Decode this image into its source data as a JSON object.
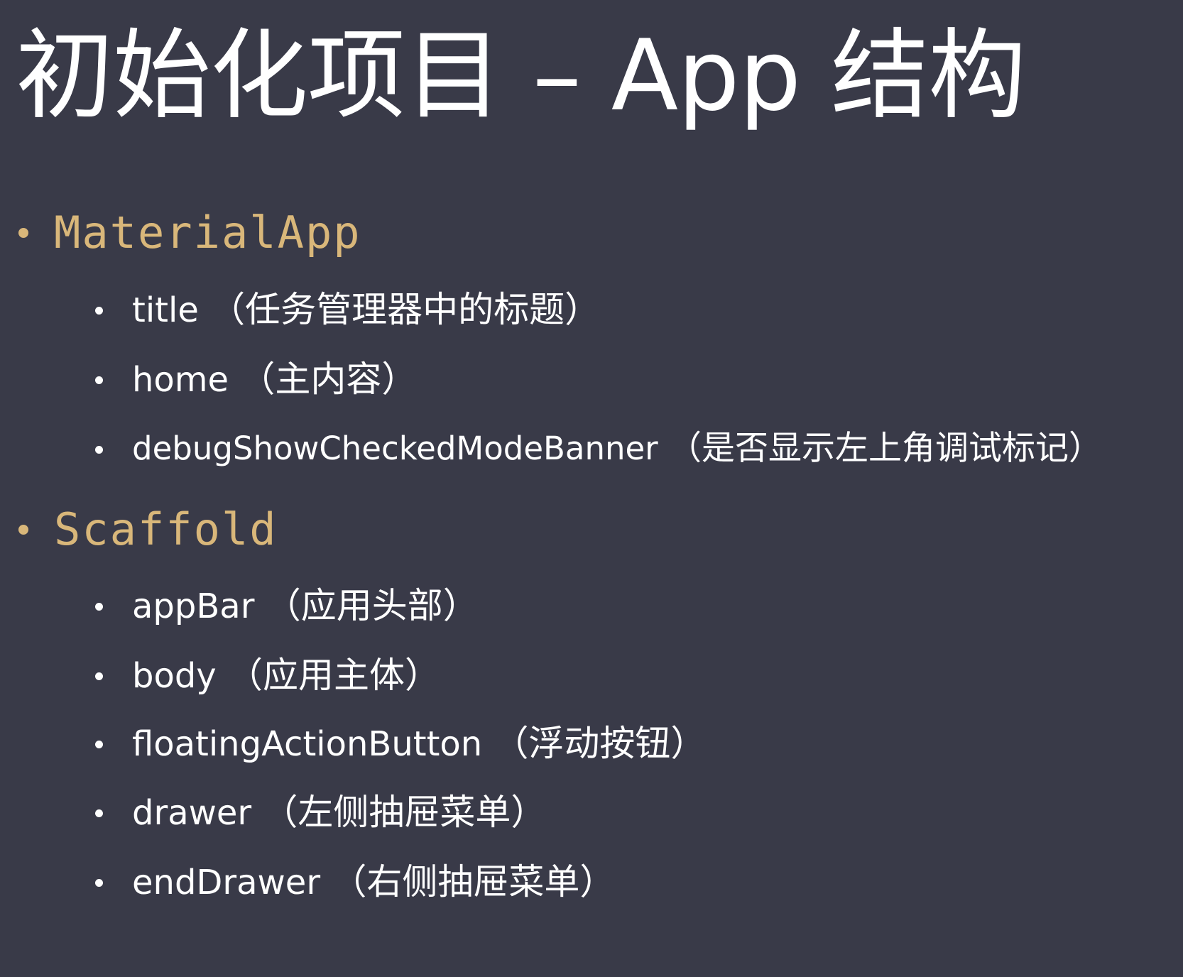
{
  "slide": {
    "title": "初始化项目 – App 结构",
    "sections": [
      {
        "name": "MaterialApp",
        "items": [
          {
            "key": "title",
            "note": "（任务管理器中的标题）"
          },
          {
            "key": "home",
            "note": "（主内容）"
          },
          {
            "key": "debugShowCheckedModeBanner",
            "note": "（是否显示左上角调试标记）"
          }
        ]
      },
      {
        "name": "Scaffold",
        "items": [
          {
            "key": "appBar",
            "note": "（应用头部）"
          },
          {
            "key": "body",
            "note": "（应用主体）"
          },
          {
            "key": "floatingActionButton",
            "note": "（浮动按钮）"
          },
          {
            "key": "drawer",
            "note": "（左侧抽屉菜单）"
          },
          {
            "key": "endDrawer",
            "note": "（右侧抽屉菜单）"
          }
        ]
      }
    ]
  },
  "colors": {
    "background": "#393a48",
    "accent": "#d9b77a",
    "text": "#ffffff"
  }
}
